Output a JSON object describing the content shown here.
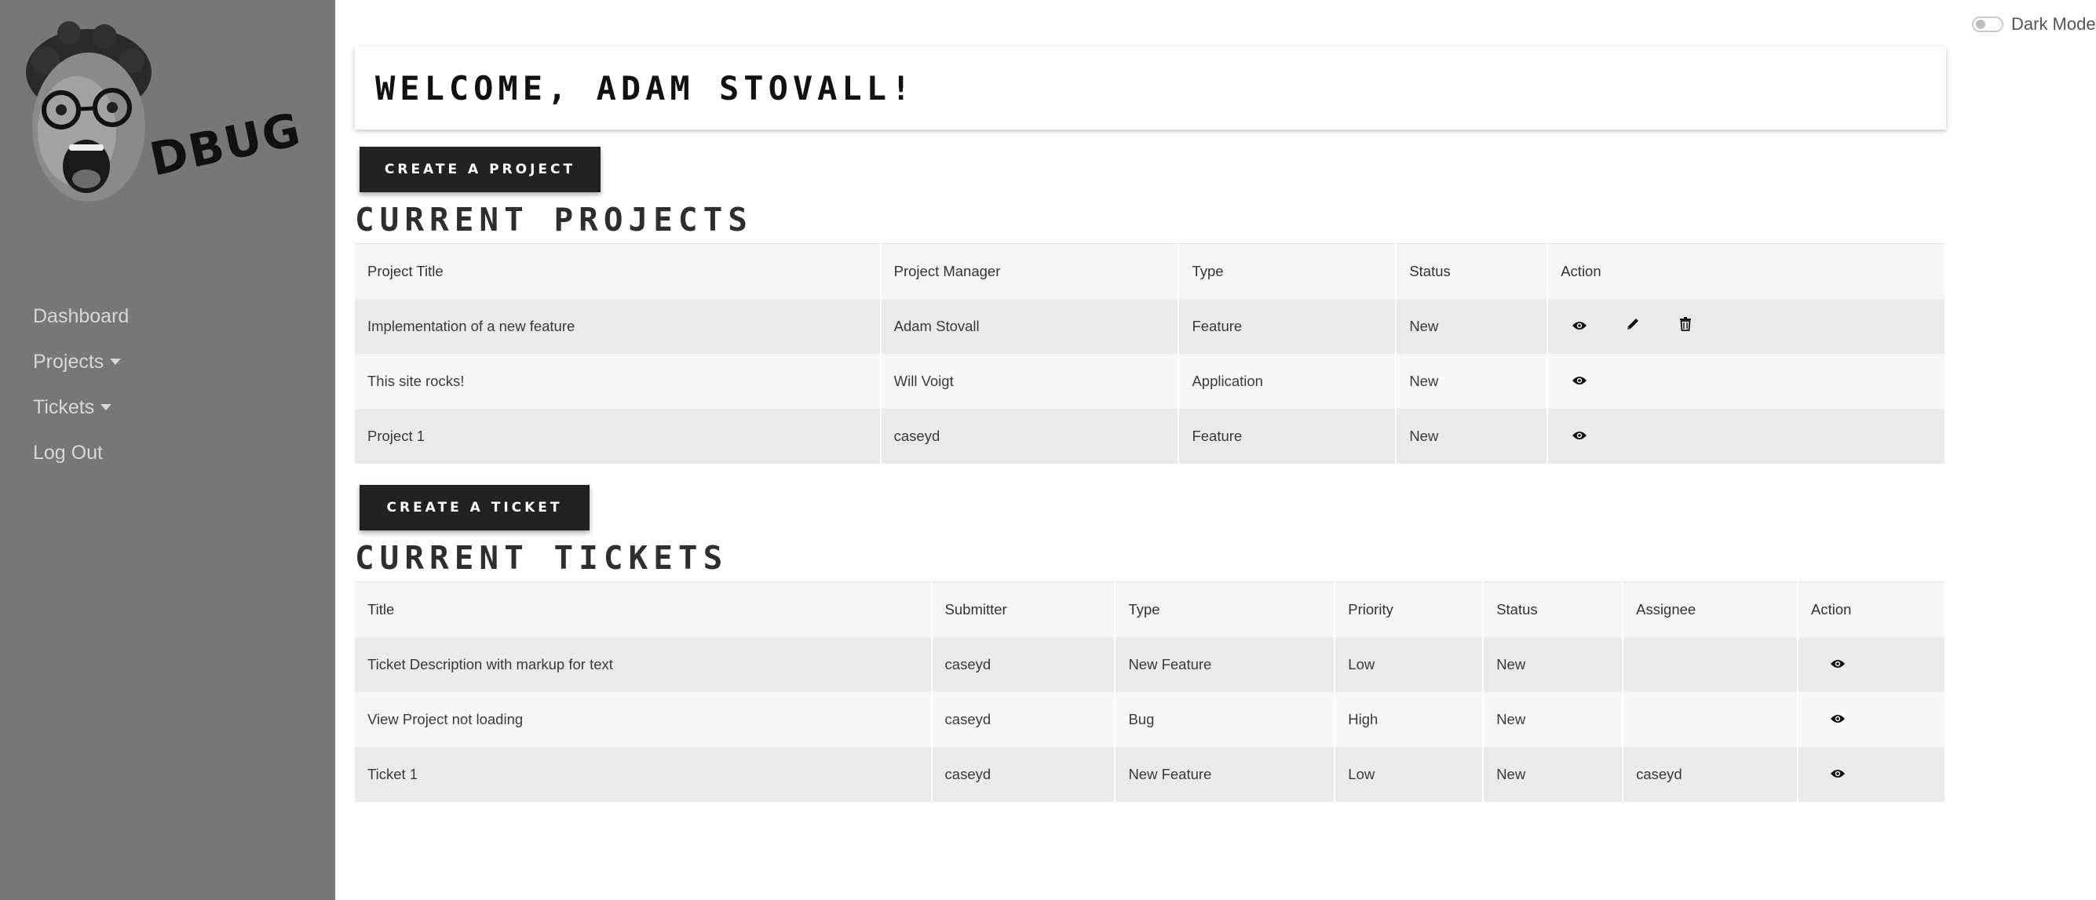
{
  "sidebar": {
    "logo_text": "DBUG",
    "nav": [
      {
        "label": "Dashboard",
        "has_caret": false
      },
      {
        "label": "Projects",
        "has_caret": true
      },
      {
        "label": "Tickets",
        "has_caret": true
      },
      {
        "label": "Log Out",
        "has_caret": false
      }
    ]
  },
  "header": {
    "dark_mode_label": "Dark Mode",
    "welcome": "WELCOME, ADAM STOVALL!"
  },
  "projects": {
    "create_label": "CREATE A PROJECT",
    "title": "CURRENT PROJECTS",
    "columns": [
      "Project Title",
      "Project Manager",
      "Type",
      "Status",
      "Action"
    ],
    "rows": [
      {
        "title": "Implementation of a new feature",
        "manager": "Adam Stovall",
        "type": "Feature",
        "status": "New",
        "actions": [
          "eye-icon",
          "pencil-icon",
          "trash-icon"
        ]
      },
      {
        "title": "This site rocks!",
        "manager": "Will Voigt",
        "type": "Application",
        "status": "New",
        "actions": [
          "eye-icon"
        ]
      },
      {
        "title": "Project 1",
        "manager": "caseyd",
        "type": "Feature",
        "status": "New",
        "actions": [
          "eye-icon"
        ]
      }
    ]
  },
  "tickets": {
    "create_label": "CREATE A TICKET",
    "title": "CURRENT TICKETS",
    "columns": [
      "Title",
      "Submitter",
      "Type",
      "Priority",
      "Status",
      "Assignee",
      "Action"
    ],
    "rows": [
      {
        "title": "Ticket Description with markup for text",
        "submitter": "caseyd",
        "type": "New Feature",
        "priority": "Low",
        "status": "New",
        "assignee": "",
        "actions": [
          "eye-icon"
        ]
      },
      {
        "title": "View Project not loading",
        "submitter": "caseyd",
        "type": "Bug",
        "priority": "High",
        "status": "New",
        "assignee": "",
        "actions": [
          "eye-icon"
        ]
      },
      {
        "title": "Ticket 1",
        "submitter": "caseyd",
        "type": "New Feature",
        "priority": "Low",
        "status": "New",
        "assignee": "caseyd",
        "actions": [
          "eye-icon"
        ]
      }
    ]
  }
}
